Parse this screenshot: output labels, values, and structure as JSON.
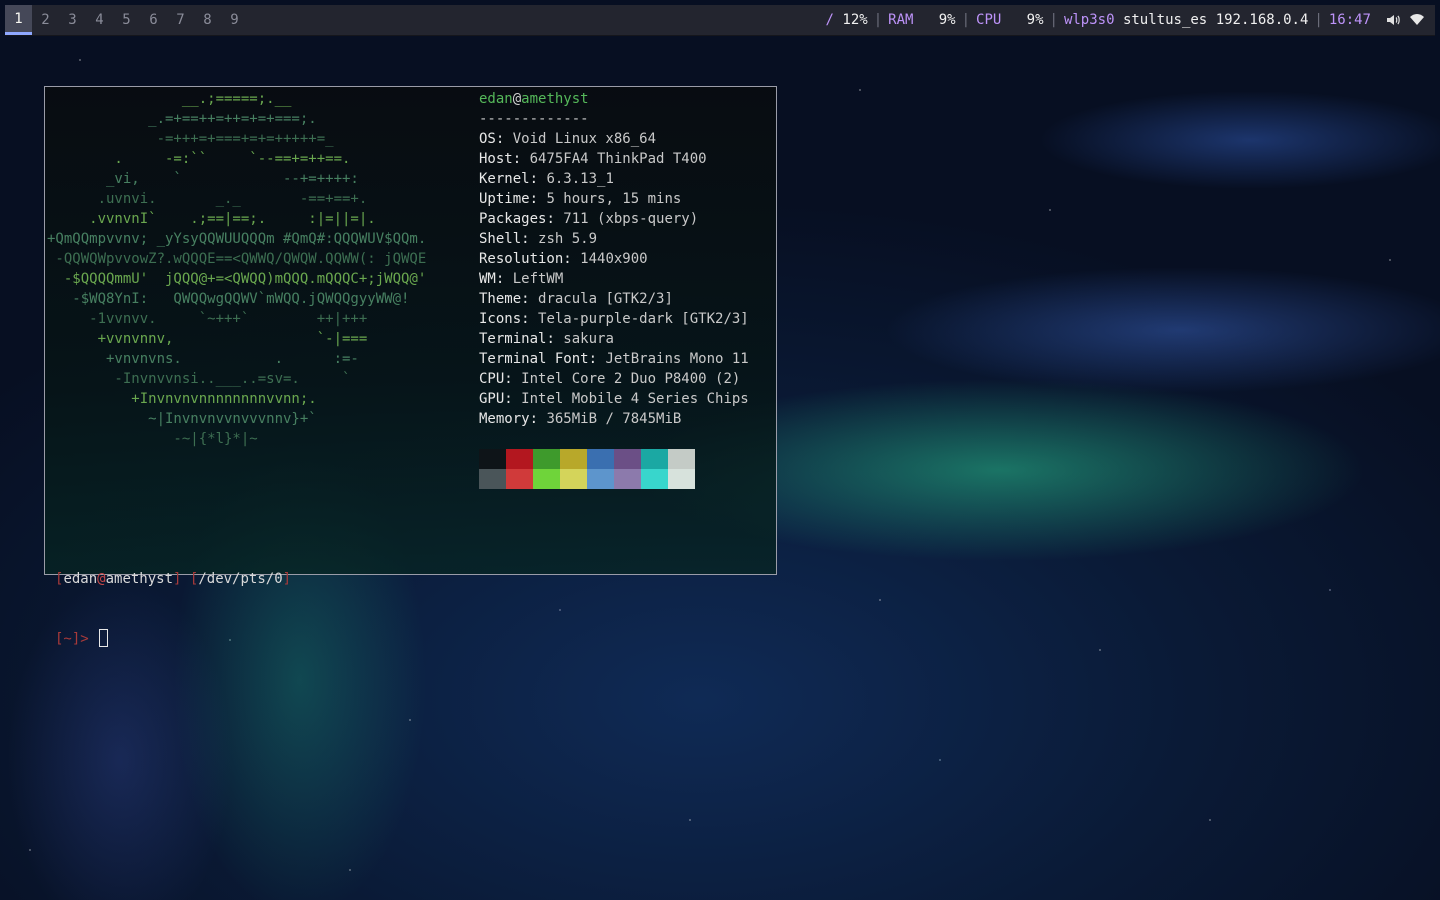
{
  "topbar": {
    "workspaces": [
      {
        "label": "1",
        "active": true
      },
      {
        "label": "2"
      },
      {
        "label": "3"
      },
      {
        "label": "4"
      },
      {
        "label": "5"
      },
      {
        "label": "6"
      },
      {
        "label": "7"
      },
      {
        "label": "8"
      },
      {
        "label": "9"
      }
    ],
    "disk_label": "/",
    "disk_value": "12%",
    "ram_label": "RAM",
    "ram_value": "9%",
    "cpu_label": "CPU",
    "cpu_value": "9%",
    "net_iface": "wlp3s0",
    "net_ssid": "stultus_es",
    "net_ip": "192.168.0.4",
    "clock": "16:47",
    "separator": "|",
    "icons": [
      "volume-icon",
      "wifi-icon"
    ]
  },
  "terminal": {
    "logo_lines": [
      "                __.;=====;.__",
      "            _.=+==++=++=+=+===;.",
      "             -=+++=+===+=+=+++++=_",
      "        .     -=:``     `--==+=++==.",
      "       _vi,    `            --+=++++:",
      "      .uvnvi.       _._       -==+==+.",
      "     .vvnvnI`    .;==|==;.     :|=||=|.",
      "+QmQQmpvvnv; _yYsyQQWUUQQQm #QmQ#:QQQWUV$QQm.",
      " -QQWQWpvvowZ?.wQQQE==<QWWQ/QWQW.QQWW(: jQWQE",
      "  -$QQQQmmU'  jQQQ@+=<QWQQ)mQQQ.mQQQC+;jWQQ@'",
      "   -$WQ8YnI:   QWQQwgQQWV`mWQQ.jQWQQgyyWW@!",
      "     -1vvnvv.     `~+++`        ++|+++",
      "      +vvnvnnv,                 `-|===",
      "       +vnvnvns.           .      :=-",
      "        -Invnvvnsi..___..=sv=.     `",
      "          +Invnvnvnnnnnnnnvvnn;.",
      "            ~|Invnvnvvnvvvnnv}+`",
      "               -~|{*l}*|~"
    ],
    "user": "edan",
    "at": "@",
    "host": "amethyst",
    "divider": "-------------",
    "info": [
      {
        "key": "OS",
        "value": "Void Linux x86_64"
      },
      {
        "key": "Host",
        "value": "6475FA4 ThinkPad T400"
      },
      {
        "key": "Kernel",
        "value": "6.3.13_1"
      },
      {
        "key": "Uptime",
        "value": "5 hours, 15 mins"
      },
      {
        "key": "Packages",
        "value": "711 (xbps-query)"
      },
      {
        "key": "Shell",
        "value": "zsh 5.9"
      },
      {
        "key": "Resolution",
        "value": "1440x900"
      },
      {
        "key": "WM",
        "value": "LeftWM"
      },
      {
        "key": "Theme",
        "value": "dracula [GTK2/3]"
      },
      {
        "key": "Icons",
        "value": "Tela-purple-dark [GTK2/3]"
      },
      {
        "key": "Terminal",
        "value": "sakura"
      },
      {
        "key": "Terminal Font",
        "value": "JetBrains Mono 11"
      },
      {
        "key": "CPU",
        "value": "Intel Core 2 Duo P8400 (2)"
      },
      {
        "key": "GPU",
        "value": "Intel Mobile 4 Series Chips"
      },
      {
        "key": "Memory",
        "value": "365MiB / 7845MiB"
      }
    ],
    "palette_top": [
      "#0e1418",
      "#b3171f",
      "#3e9a2c",
      "#b8a82a",
      "#3a6fb0",
      "#6b4f86",
      "#1ba8a3",
      "#c4cbc6"
    ],
    "palette_bottom": [
      "#4a5559",
      "#d03a3a",
      "#6fd43a",
      "#d4d45a",
      "#5d95cc",
      "#8c7aac",
      "#38d6cc",
      "#d7e2dc"
    ],
    "prompt": {
      "open_bracket": "[",
      "user": "edan",
      "at": "@",
      "host": "amethyst",
      "close_bracket": "]",
      "path_open": "[",
      "path": "/dev/pts/0",
      "path_close": "]",
      "cwd_line": "[~]>"
    }
  }
}
